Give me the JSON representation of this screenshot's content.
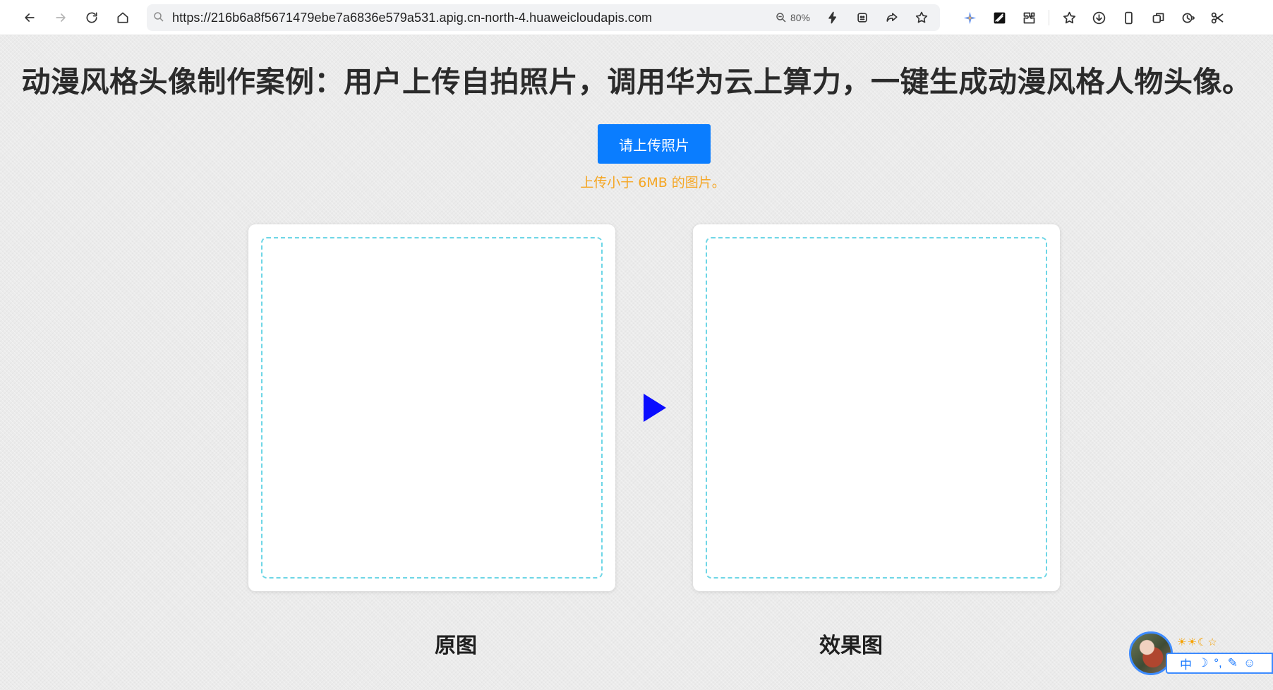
{
  "browser": {
    "url": "https://216b6a8f5671479ebe7a6836e579a531.apig.cn-north-4.huaweicloudapis.com",
    "zoom": "80%",
    "nav_icons": [
      "back-icon",
      "forward-icon",
      "reload-icon",
      "home-icon"
    ],
    "address_icons": [
      "zoom-out-icon",
      "lightning-icon",
      "reader-icon",
      "share-icon",
      "favorite-star-icon"
    ],
    "extension_icons": [
      "ai-assistant-icon",
      "extension-icon",
      "puzzle-icon",
      "bookmarks-icon",
      "download-icon",
      "mobile-icon",
      "tabs-icon",
      "history-icon",
      "screenshot-icon"
    ]
  },
  "page": {
    "headline": "动漫风格头像制作案例：用户上传自拍照片，调用华为云上算力，一键生成动漫风格人物头像。",
    "upload_button": "请上传照片",
    "upload_hint": "上传小于 6MB 的图片。",
    "caption_original": "原图",
    "caption_result": "效果图"
  },
  "widget": {
    "status_icons": "☀☀☾☆",
    "toolbar_items": [
      "中",
      "☽",
      "°,",
      "✎",
      "☺"
    ]
  },
  "colors": {
    "upload_button": "#0a7dff",
    "hint": "#f5a623",
    "dropzone_border": "#6ed6e6",
    "arrow": "#0a0cff"
  }
}
